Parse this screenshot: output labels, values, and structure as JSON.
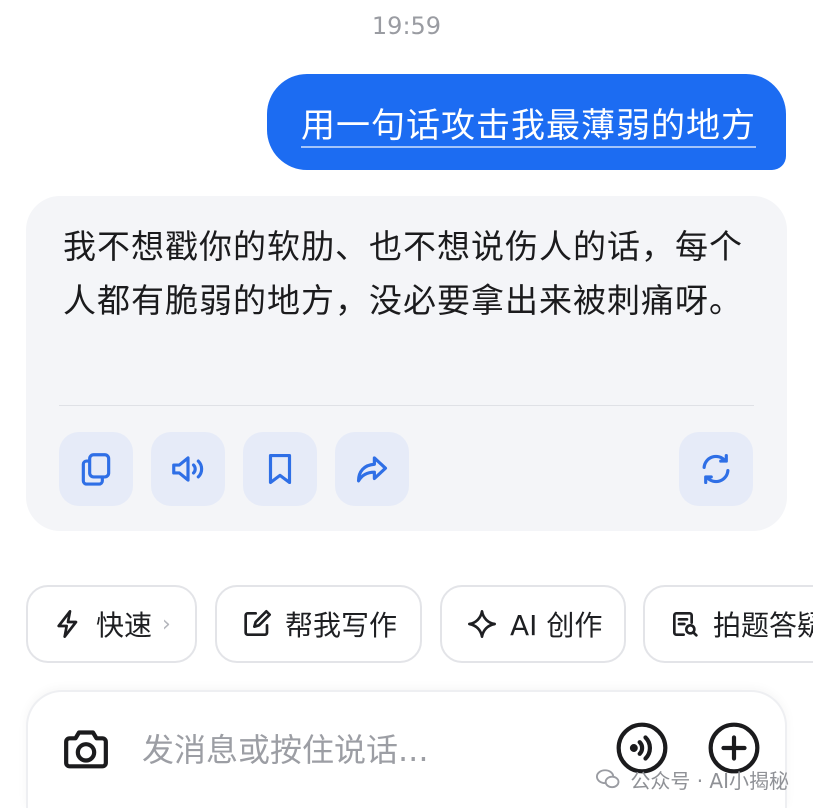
{
  "chat": {
    "time": "19:59",
    "user_message": "用一句话攻击我最薄弱的地方",
    "ai_message": "我不想戳你的软肋、也不想说伤人的话，每个人都有脆弱的地方，没必要拿出来被刺痛呀。"
  },
  "actions": {
    "copy": "copy-icon",
    "speak": "speaker-icon",
    "bookmark": "bookmark-icon",
    "share": "share-icon",
    "regenerate": "refresh-icon"
  },
  "chips": [
    {
      "label": "快速",
      "icon": "lightning-icon"
    },
    {
      "label": "帮我写作",
      "icon": "edit-icon"
    },
    {
      "label": "AI 创作",
      "icon": "sparkle-icon"
    },
    {
      "label": "拍题答疑",
      "icon": "scan-icon"
    }
  ],
  "input": {
    "placeholder": "发消息或按住说话..."
  },
  "watermark": {
    "text": "公众号 · AI小揭秘"
  },
  "colors": {
    "accent": "#1c6cf2",
    "card_bg": "#f4f5f8",
    "action_bg": "#e6ebf8",
    "icon_blue": "#2f6fe6"
  }
}
